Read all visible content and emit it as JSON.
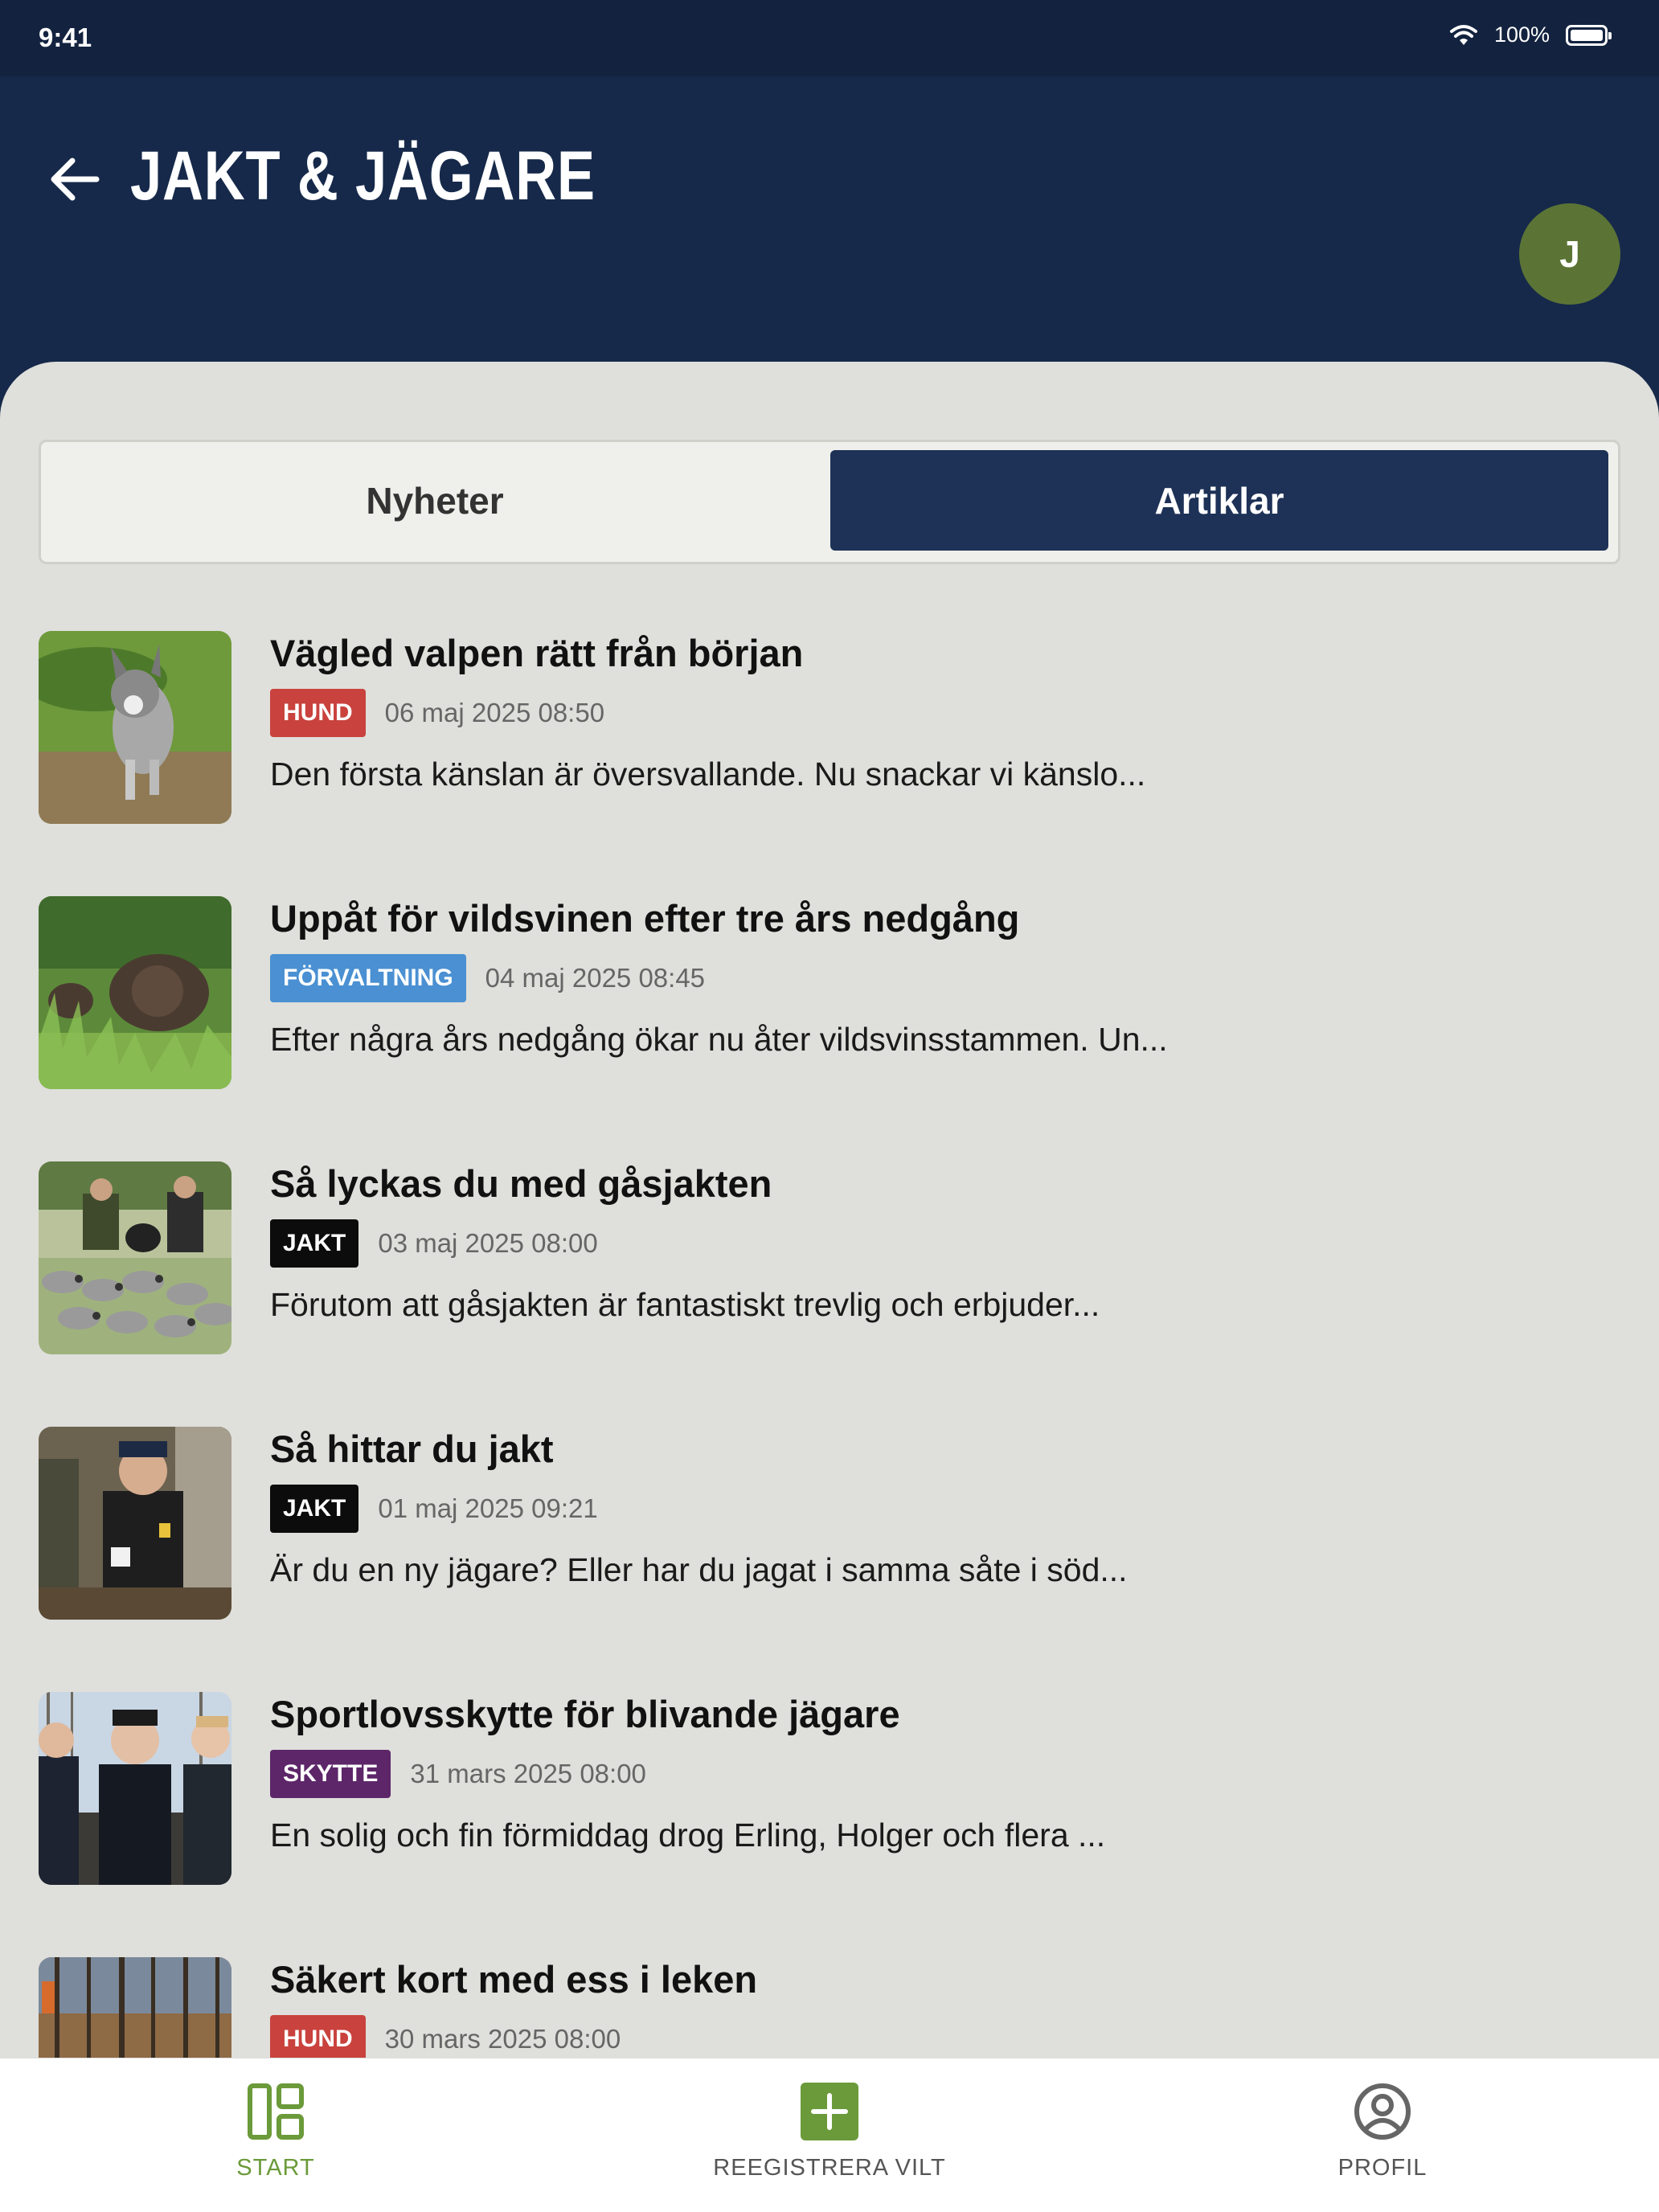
{
  "status_bar": {
    "time": "9:41",
    "battery": "100%"
  },
  "header": {
    "title": "JAKT & JÄGARE",
    "avatar_initial": "J",
    "back_icon": "arrow-left-icon"
  },
  "tabs": [
    {
      "label": "Nyheter",
      "active": false
    },
    {
      "label": "Artiklar",
      "active": true
    }
  ],
  "articles": [
    {
      "title": "Vägled valpen rätt från början",
      "tag": "HUND",
      "tag_color": "#c9423d",
      "date": "06 maj 2025 08:50",
      "excerpt": "Den första känslan är översvallande. Nu snackar vi känslo..."
    },
    {
      "title": "Uppåt för vildsvinen efter tre års nedgång",
      "tag": "FÖRVALTNING",
      "tag_color": "#4a90d2",
      "date": "04 maj 2025 08:45",
      "excerpt": "Efter några års nedgång ökar nu åter vildsvinsstammen. Un..."
    },
    {
      "title": "Så lyckas du med gåsjakten",
      "tag": "JAKT",
      "tag_color": "#0c0c0c",
      "date": "03 maj 2025 08:00",
      "excerpt": "Förutom att gåsjakten är fantastiskt trevlig och erbjuder..."
    },
    {
      "title": "Så hittar du jakt",
      "tag": "JAKT",
      "tag_color": "#0c0c0c",
      "date": "01 maj 2025 09:21",
      "excerpt": "Är du en ny jägare? Eller har du jagat i samma såte i söd..."
    },
    {
      "title": "Sportlovsskytte för blivande jägare",
      "tag": "SKYTTE",
      "tag_color": "#5d2669",
      "date": "31 mars 2025 08:00",
      "excerpt": "En solig och fin förmiddag drog Erling, Holger och flera ..."
    },
    {
      "title": "Säkert kort med ess i leken",
      "tag": "HUND",
      "tag_color": "#c9423d",
      "date": "30 mars 2025 08:00",
      "excerpt": ""
    }
  ],
  "bottom_nav": [
    {
      "label": "START",
      "icon": "dashboard-icon",
      "active": true
    },
    {
      "label": "REEGISTRERA VILT",
      "icon": "plus-square-icon",
      "active": false
    },
    {
      "label": "PROFIL",
      "icon": "user-circle-icon",
      "active": false
    }
  ]
}
